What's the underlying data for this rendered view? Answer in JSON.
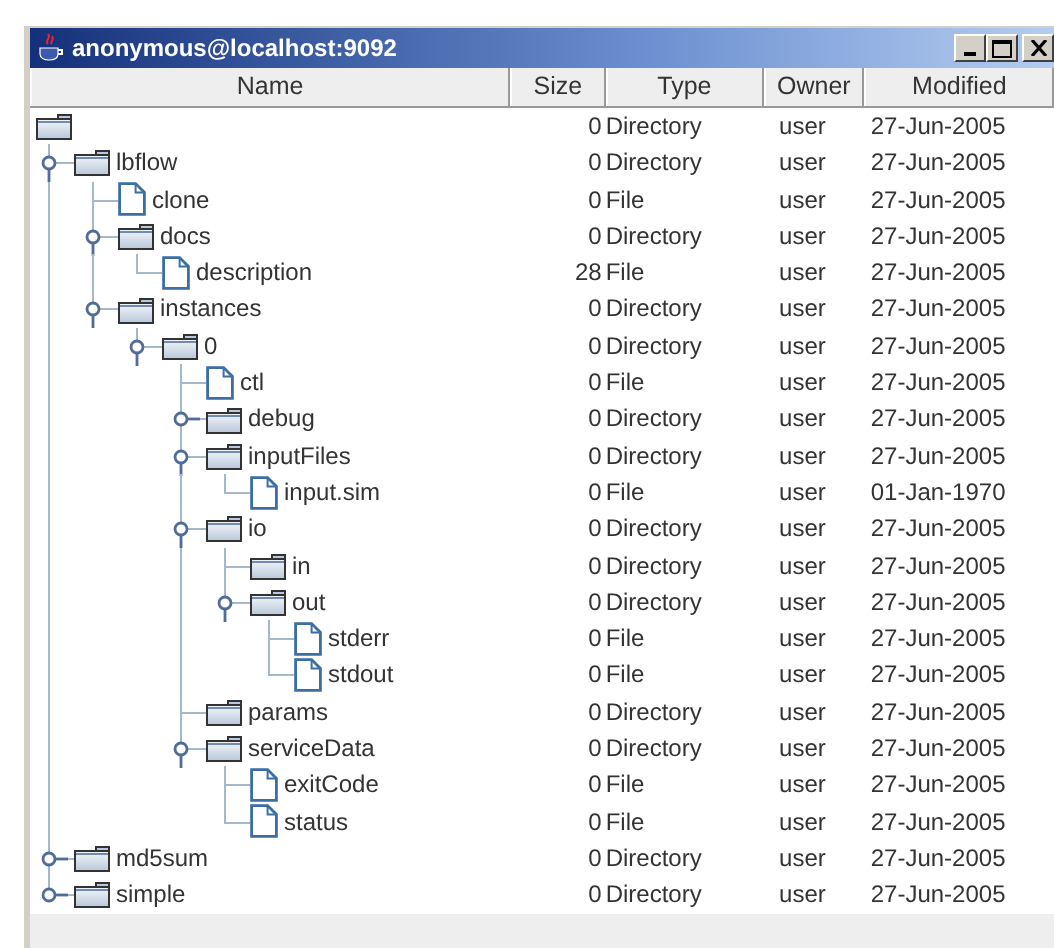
{
  "window": {
    "title": "anonymous@localhost:9092"
  },
  "table": {
    "columns": [
      "Name",
      "Size",
      "Type",
      "Owner",
      "Modified"
    ],
    "rows": [
      {
        "kind": "directory",
        "size": "0",
        "type": "Directory",
        "owner": "user",
        "modified": "27-Jun-2005",
        "children": [
          {
            "kind": "directory",
            "name": "lbflow",
            "size": "0",
            "type": "Directory",
            "owner": "user",
            "modified": "27-Jun-2005",
            "expanded": true,
            "children": [
              {
                "kind": "file",
                "name": "clone",
                "size": "0",
                "type": "File",
                "owner": "user",
                "modified": "27-Jun-2005"
              },
              {
                "kind": "directory",
                "name": "docs",
                "size": "0",
                "type": "Directory",
                "owner": "user",
                "modified": "27-Jun-2005",
                "expanded": true,
                "children": [
                  {
                    "kind": "file",
                    "name": "description",
                    "size": "28",
                    "type": "File",
                    "owner": "user",
                    "modified": "27-Jun-2005"
                  }
                ]
              },
              {
                "kind": "directory",
                "name": "instances",
                "size": "0",
                "type": "Directory",
                "owner": "user",
                "modified": "27-Jun-2005",
                "expanded": true,
                "children": [
                  {
                    "kind": "directory",
                    "name": "0",
                    "size": "0",
                    "type": "Directory",
                    "owner": "user",
                    "modified": "27-Jun-2005",
                    "expanded": true,
                    "children": [
                      {
                        "kind": "file",
                        "name": "ctl",
                        "size": "0",
                        "type": "File",
                        "owner": "user",
                        "modified": "27-Jun-2005"
                      },
                      {
                        "kind": "directory",
                        "name": "debug",
                        "size": "0",
                        "type": "Directory",
                        "owner": "user",
                        "modified": "27-Jun-2005",
                        "expanded": false
                      },
                      {
                        "kind": "directory",
                        "name": "inputFiles",
                        "size": "0",
                        "type": "Directory",
                        "owner": "user",
                        "modified": "27-Jun-2005",
                        "expanded": true,
                        "children": [
                          {
                            "kind": "file",
                            "name": "input.sim",
                            "size": "0",
                            "type": "File",
                            "owner": "user",
                            "modified": "01-Jan-1970"
                          }
                        ]
                      },
                      {
                        "kind": "directory",
                        "name": "io",
                        "size": "0",
                        "type": "Directory",
                        "owner": "user",
                        "modified": "27-Jun-2005",
                        "expanded": true,
                        "children": [
                          {
                            "kind": "directory",
                            "name": "in",
                            "size": "0",
                            "type": "Directory",
                            "owner": "user",
                            "modified": "27-Jun-2005"
                          },
                          {
                            "kind": "directory",
                            "name": "out",
                            "size": "0",
                            "type": "Directory",
                            "owner": "user",
                            "modified": "27-Jun-2005",
                            "expanded": true,
                            "children": [
                              {
                                "kind": "file",
                                "name": "stderr",
                                "size": "0",
                                "type": "File",
                                "owner": "user",
                                "modified": "27-Jun-2005"
                              },
                              {
                                "kind": "file",
                                "name": "stdout",
                                "size": "0",
                                "type": "File",
                                "owner": "user",
                                "modified": "27-Jun-2005"
                              }
                            ]
                          }
                        ]
                      },
                      {
                        "kind": "directory",
                        "name": "params",
                        "size": "0",
                        "type": "Directory",
                        "owner": "user",
                        "modified": "27-Jun-2005"
                      },
                      {
                        "kind": "directory",
                        "name": "serviceData",
                        "size": "0",
                        "type": "Directory",
                        "owner": "user",
                        "modified": "27-Jun-2005",
                        "expanded": true,
                        "children": [
                          {
                            "kind": "file",
                            "name": "exitCode",
                            "size": "0",
                            "type": "File",
                            "owner": "user",
                            "modified": "27-Jun-2005"
                          },
                          {
                            "kind": "file",
                            "name": "status",
                            "size": "0",
                            "type": "File",
                            "owner": "user",
                            "modified": "27-Jun-2005"
                          }
                        ]
                      }
                    ]
                  }
                ]
              }
            ]
          },
          {
            "kind": "directory",
            "name": "md5sum",
            "size": "0",
            "type": "Directory",
            "owner": "user",
            "modified": "27-Jun-2005",
            "expanded": false
          },
          {
            "kind": "directory",
            "name": "simple",
            "size": "0",
            "type": "Directory",
            "owner": "user",
            "modified": "27-Jun-2005",
            "expanded": false
          }
        ]
      }
    ]
  }
}
